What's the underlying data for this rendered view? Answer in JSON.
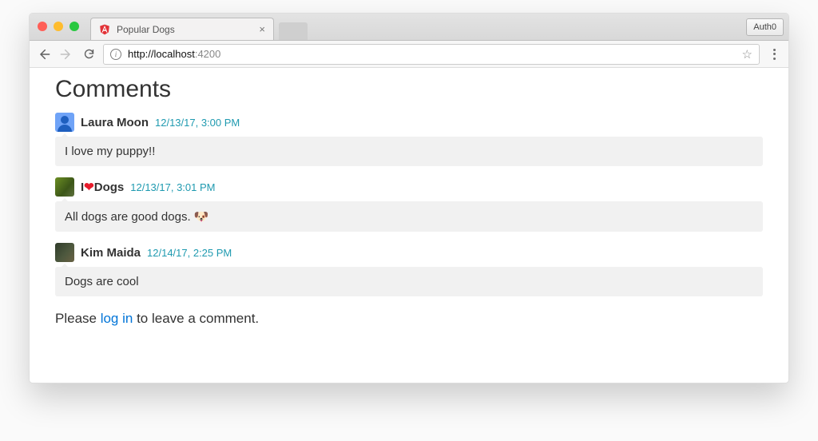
{
  "browser": {
    "tab_title": "Popular Dogs",
    "url_host": "http://localhost",
    "url_path": ":4200",
    "ext_button": "Auth0"
  },
  "page": {
    "heading": "Comments",
    "comments": [
      {
        "name": "Laura Moon",
        "time": "12/13/17, 3:00 PM",
        "body": "I love my puppy!!",
        "avatar": "generic"
      },
      {
        "name_pre": "I",
        "name_post": "Dogs",
        "heart": "❤",
        "time": "12/13/17, 3:01 PM",
        "body": "All dogs are good dogs. 🐶",
        "avatar": "photo1"
      },
      {
        "name": "Kim Maida",
        "time": "12/14/17, 2:25 PM",
        "body": "Dogs are cool",
        "avatar": "photo2"
      }
    ],
    "footer_pre": "Please ",
    "footer_link": "log in",
    "footer_post": " to leave a comment."
  }
}
